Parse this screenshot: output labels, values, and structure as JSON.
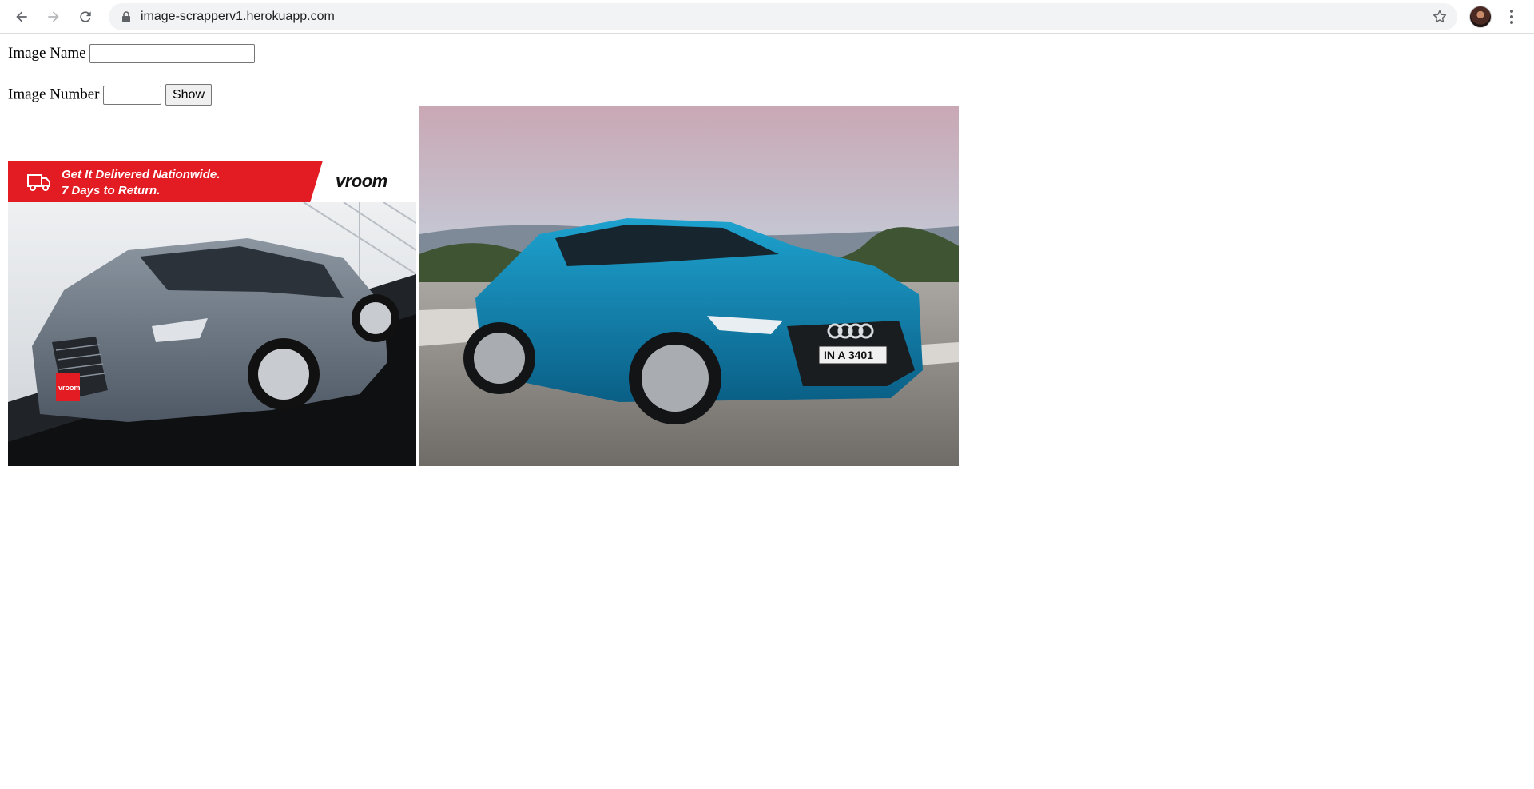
{
  "browser": {
    "url": "image-scrapperv1.herokuapp.com"
  },
  "form": {
    "image_name_label": "Image Name",
    "image_name_value": "",
    "image_number_label": "Image Number",
    "image_number_value": "",
    "show_button_label": "Show"
  },
  "results": [
    {
      "ad_banner_line1": "Get It Delivered Nationwide.",
      "ad_banner_line2": "7 Days to Return.",
      "ad_brand": "vroom",
      "plate": "vroom",
      "car_color": "#6f7a86"
    },
    {
      "plate": "IN A 3401",
      "car_color": "#0f7fae"
    }
  ],
  "colors": {
    "ad_red": "#e31b23",
    "omnibox_bg": "#f1f3f4"
  }
}
